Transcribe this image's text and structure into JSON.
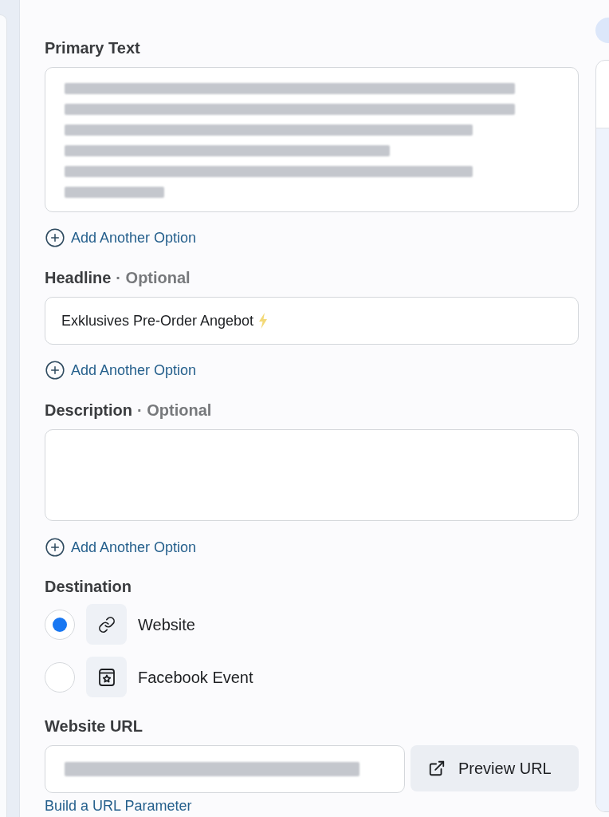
{
  "primary_text": {
    "label": "Primary Text",
    "add_option": "Add Another Option"
  },
  "headline": {
    "label": "Headline",
    "optional": "· Optional",
    "value": "Exklusives Pre-Order Angebot",
    "add_option": "Add Another Option"
  },
  "description": {
    "label": "Description",
    "optional": "· Optional",
    "add_option": "Add Another Option"
  },
  "destination": {
    "label": "Destination",
    "options": [
      {
        "label": "Website",
        "selected": true
      },
      {
        "label": "Facebook Event",
        "selected": false
      }
    ]
  },
  "website_url": {
    "label": "Website URL",
    "button": "Preview URL",
    "link": "Build a URL Parameter"
  }
}
